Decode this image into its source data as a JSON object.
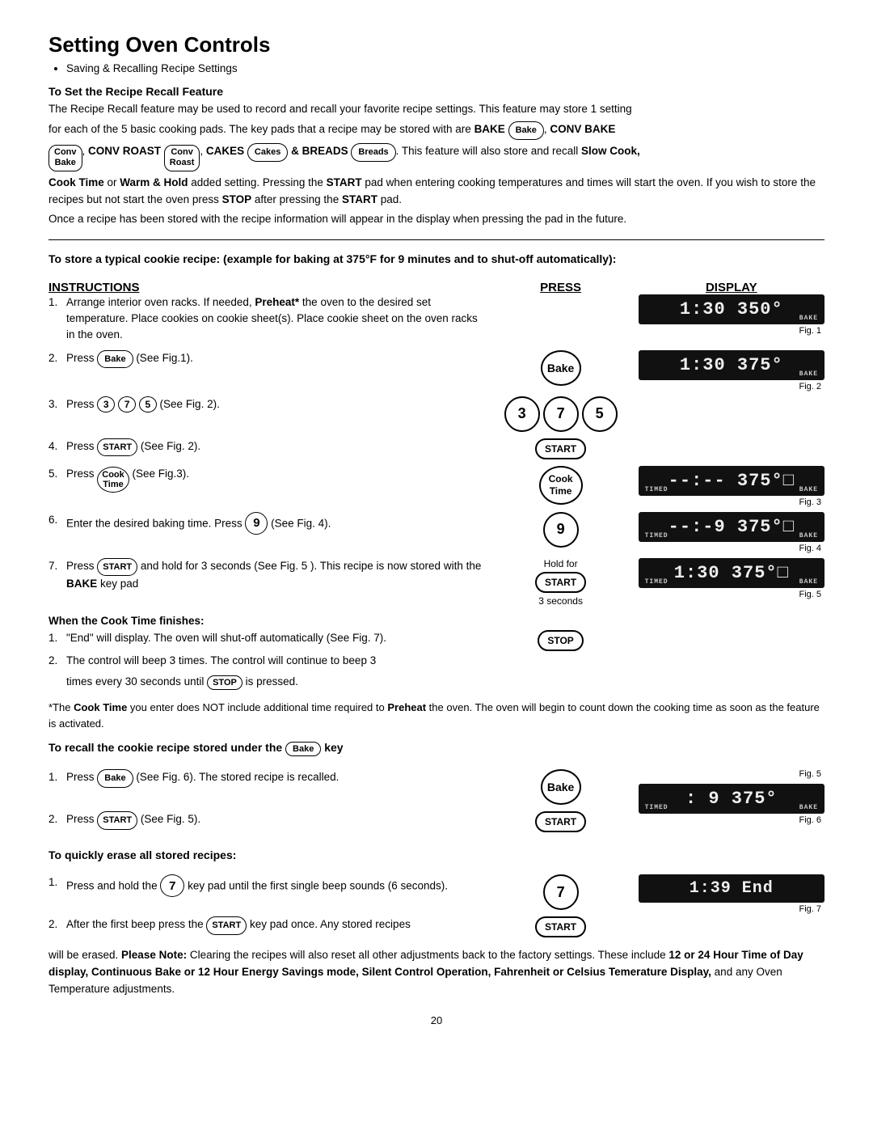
{
  "page": {
    "title": "Setting Oven Controls",
    "bullet1": "Saving & Recalling Recipe Settings",
    "section1_heading": "To Set the Recipe Recall Feature",
    "section1_para1": "The Recipe Recall feature may be used to record and recall your favorite recipe settings. This feature may store 1 setting",
    "section1_para2": "for each of the 5 basic cooking pads. The key pads that a recipe may be stored with are ",
    "section1_bold1": "BAKE",
    "section1_bake_key": "Bake",
    "section1_bold2": ", CONV BAKE",
    "section1_para3_prefix": "",
    "conv_bake_key": "Conv\nBake",
    "section1_bold3": ", CONV ROAST",
    "conv_roast_key": "Conv\nRoast",
    "section1_bold4": ", CAKES",
    "cakes_key": "Cakes",
    "section1_bold5": "& BREADS",
    "breads_key": "Breads",
    "section1_para4": ". This feature will also store and recall ",
    "slow_cook_bold": "Slow Cook,",
    "cook_time_bold": "Cook Time",
    "section1_para5": " or ",
    "warm_hold_bold": "Warm & Hold",
    "section1_para6": " added setting. Pressing the ",
    "start_bold": "START",
    "section1_para7": " pad when entering cooking temperatures and times will start the oven. If you wish to store the recipes but not start the oven press ",
    "stop_bold": "STOP",
    "section1_para8": " after pressing the ",
    "start_bold2": "START",
    "section1_para9": " pad.",
    "section1_para10": "Once a recipe has been stored with the recipe information will appear in the display when pressing the pad in the future.",
    "example_heading": "To store a typical cookie recipe: (example for baking at 375°F for 9 minutes and to shut-off automatically):",
    "col_instructions": "INSTRUCTIONS",
    "col_press": "PRESS",
    "col_display": "DISPLAY",
    "steps": [
      {
        "num": "1.",
        "text": "Arrange interior oven racks. If needed, ",
        "bold": "Preheat*",
        "text2": " the oven to the desired set temperature. Place cookies on cookie sheet(s). Place cookie sheet on the oven racks in the oven."
      },
      {
        "num": "2.",
        "text": "Press ",
        "key": "Bake",
        "text2": " (See Fig.1)."
      },
      {
        "num": "3.",
        "text": "Press ",
        "keys": [
          "3",
          "7",
          "5"
        ],
        "text2": " (See Fig. 2)."
      },
      {
        "num": "4.",
        "text": "Press ",
        "key_start": "START",
        "text2": " (See Fig. 2)."
      },
      {
        "num": "5.",
        "text": "Press ",
        "key_cooktime": "Cook\nTime",
        "text2": " (See Fig.3)."
      },
      {
        "num": "6.",
        "text": "Enter the desired baking time. Press ",
        "key_num": "9",
        "text2": " (See Fig. 4)."
      },
      {
        "num": "7.",
        "text": "Press ",
        "key_start2": "START",
        "text2": " and hold for 3 seconds (See Fig. 5 ). This recipe is now stored with the ",
        "bold": "BAKE",
        "text3": " key pad"
      }
    ],
    "when_heading": "When the Cook Time finishes:",
    "when_steps": [
      {
        "num": "1.",
        "text": "\"End\" will display. The oven will shut-off automatically (See Fig. 7)."
      },
      {
        "num": "2.",
        "text": "The control will beep 3 times. The control will continue to beep 3"
      }
    ],
    "when_continue": "times every 30 seconds until ",
    "stop_key_inline": "STOP",
    "when_continue2": " is pressed.",
    "note_asterisk": "*The ",
    "note_cooktime_bold": "Cook Time",
    "note_text": " you enter does NOT include additional time required to ",
    "note_preheat_bold": "Preheat",
    "note_text2": " the oven. The oven will begin to count down the cooking time as soon as the feature is activated.",
    "recall_heading_prefix": "To recall the cookie recipe stored under the ",
    "recall_key": "Bake",
    "recall_heading_suffix": " key",
    "recall_steps": [
      {
        "num": "1.",
        "text": "Press ",
        "key": "Bake",
        "text2": " (See Fig. 6). The stored recipe is recalled."
      },
      {
        "num": "2.",
        "text": "Press ",
        "key_start": "START",
        "text2": " (See Fig. 5)."
      }
    ],
    "erase_heading": "To quickly erase all stored recipes:",
    "erase_steps": [
      {
        "num": "1.",
        "text": "Press and hold the ",
        "key_num": "7",
        "text2": " key pad until the first single beep sounds (6 seconds)."
      },
      {
        "num": "2.",
        "text": "After the first beep press the ",
        "key_start": "START",
        "text2": " key pad once. Any stored recipes"
      }
    ],
    "erase_continue": "will be erased. ",
    "please_note_bold": "Please Note:",
    "erase_note": " Clearing the recipes will also reset all other adjustments back to the factory settings. These include ",
    "erase_bold2": "12 or 24 Hour Time of Day display,  Continuous Bake or 12 Hour Energy Savings mode, Silent Control Operation, Fahrenheit or Celsius Temerature Display,",
    "erase_note2": " and any Oven Temperature adjustments.",
    "page_number": "20",
    "displays": {
      "fig1": "1:30 350°",
      "fig1_label_left": "BAKE",
      "fig1_name": "Fig. 1",
      "fig2": "1:30 375°",
      "fig2_label_left": "BAKE",
      "fig2_name": "Fig. 2",
      "fig3": "--:-- 375°□",
      "fig3_label_left": "TIMED",
      "fig3_label_right": "BAKE",
      "fig3_name": "Fig. 3",
      "fig4": "--:-9 375°□",
      "fig4_label_left": "TIMED",
      "fig4_label_right": "BAKE",
      "fig4_name": "Fig. 4",
      "fig5": "1:30 375°□",
      "fig5_label_left": "TIMED",
      "fig5_label_right": "BAKE",
      "fig5_name": "Fig. 5",
      "fig6": ": 9 375°",
      "fig6_label_left": "TIMED",
      "fig6_label_right": "BAKE",
      "fig6_name": "Fig. 6",
      "fig7": "1:39 End",
      "fig7_name": "Fig. 7"
    }
  }
}
